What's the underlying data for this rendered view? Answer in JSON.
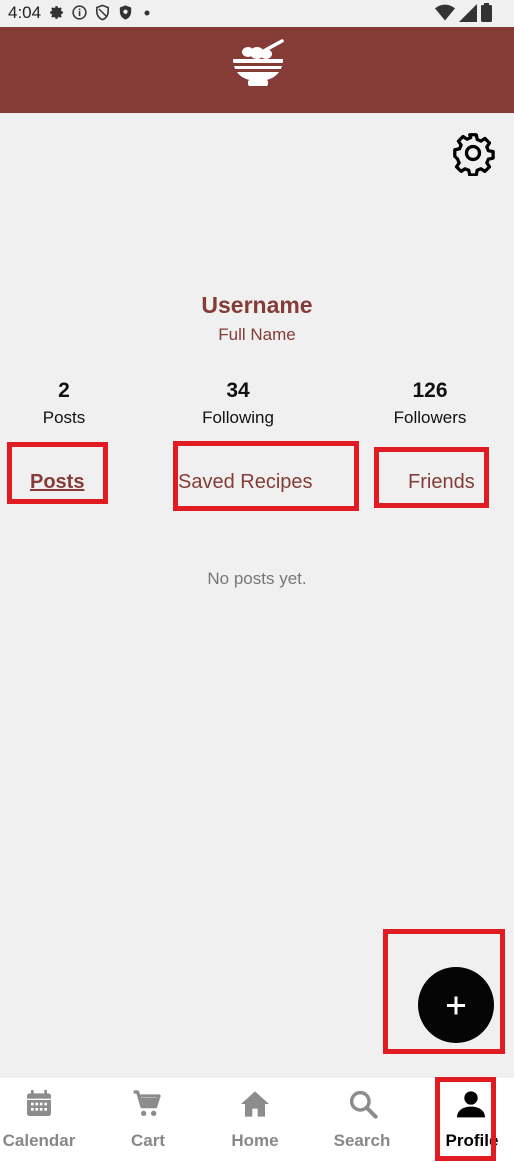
{
  "status_bar": {
    "time": "4:04",
    "left_icons": [
      "gear-icon",
      "info-icon",
      "shield-icon",
      "vpn-shield-icon",
      "dot-icon"
    ],
    "right_icons": [
      "wifi-icon",
      "signal-icon",
      "battery-icon"
    ]
  },
  "app_bar": {
    "logo_icon": "rice-bowl-icon",
    "background_color": "#853c37"
  },
  "settings": {
    "icon": "gear-icon"
  },
  "profile": {
    "username": "Username",
    "full_name": "Full Name",
    "accent_color": "#853c37"
  },
  "stats": [
    {
      "value": "2",
      "label": "Posts"
    },
    {
      "value": "34",
      "label": "Following"
    },
    {
      "value": "126",
      "label": "Followers"
    }
  ],
  "tabs": {
    "posts": "Posts",
    "saved": "Saved Recipes",
    "friends": "Friends",
    "active": "Posts"
  },
  "empty_message": "No posts yet.",
  "fab": {
    "icon": "plus-icon"
  },
  "highlight_color": "#e11b22",
  "bottom_nav": {
    "items": [
      {
        "label": "Calendar",
        "icon": "calendar-icon"
      },
      {
        "label": "Cart",
        "icon": "cart-icon"
      },
      {
        "label": "Home",
        "icon": "home-icon"
      },
      {
        "label": "Search",
        "icon": "search-icon"
      },
      {
        "label": "Profile",
        "icon": "person-icon"
      }
    ],
    "active": "Profile"
  }
}
